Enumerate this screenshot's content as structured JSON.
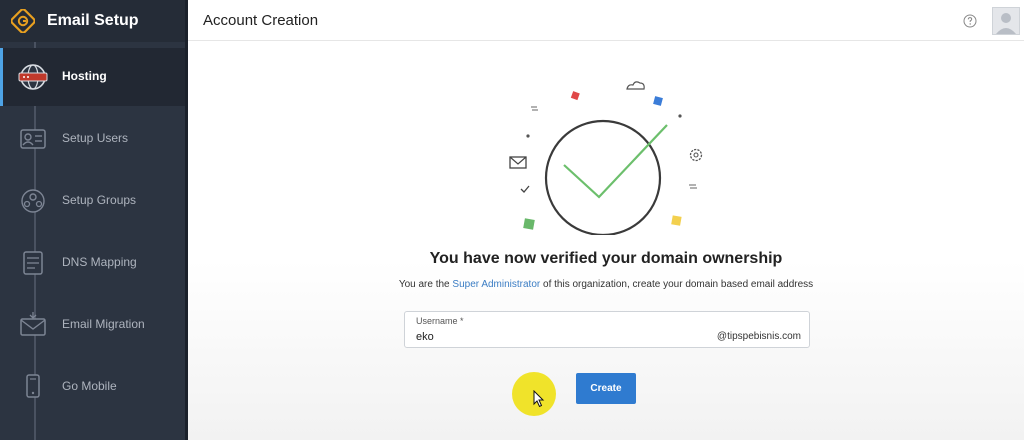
{
  "app": {
    "title": "Email Setup"
  },
  "sidebar": {
    "items": [
      {
        "label": "Hosting",
        "icon": "globe-server-icon",
        "active": true
      },
      {
        "label": "Setup Users",
        "icon": "user-card-icon"
      },
      {
        "label": "Setup Groups",
        "icon": "group-icon"
      },
      {
        "label": "DNS Mapping",
        "icon": "dns-document-icon"
      },
      {
        "label": "Email Migration",
        "icon": "envelope-icon"
      },
      {
        "label": "Go Mobile",
        "icon": "mobile-icon"
      }
    ]
  },
  "header": {
    "title": "Account Creation"
  },
  "main": {
    "headline": "You have now verified your domain ownership",
    "subline_pre": "You are the ",
    "subline_link": "Super Administrator",
    "subline_post": " of this organization, create your domain based email address",
    "username": {
      "label": "Username *",
      "value": "eko",
      "domain_suffix": "@tipspebisnis.com"
    },
    "create_label": "Create"
  },
  "colors": {
    "sidebar_bg": "#2c3441",
    "accent": "#2f7bd0",
    "check": "#6cbf6c",
    "link": "#3b7dc4"
  }
}
